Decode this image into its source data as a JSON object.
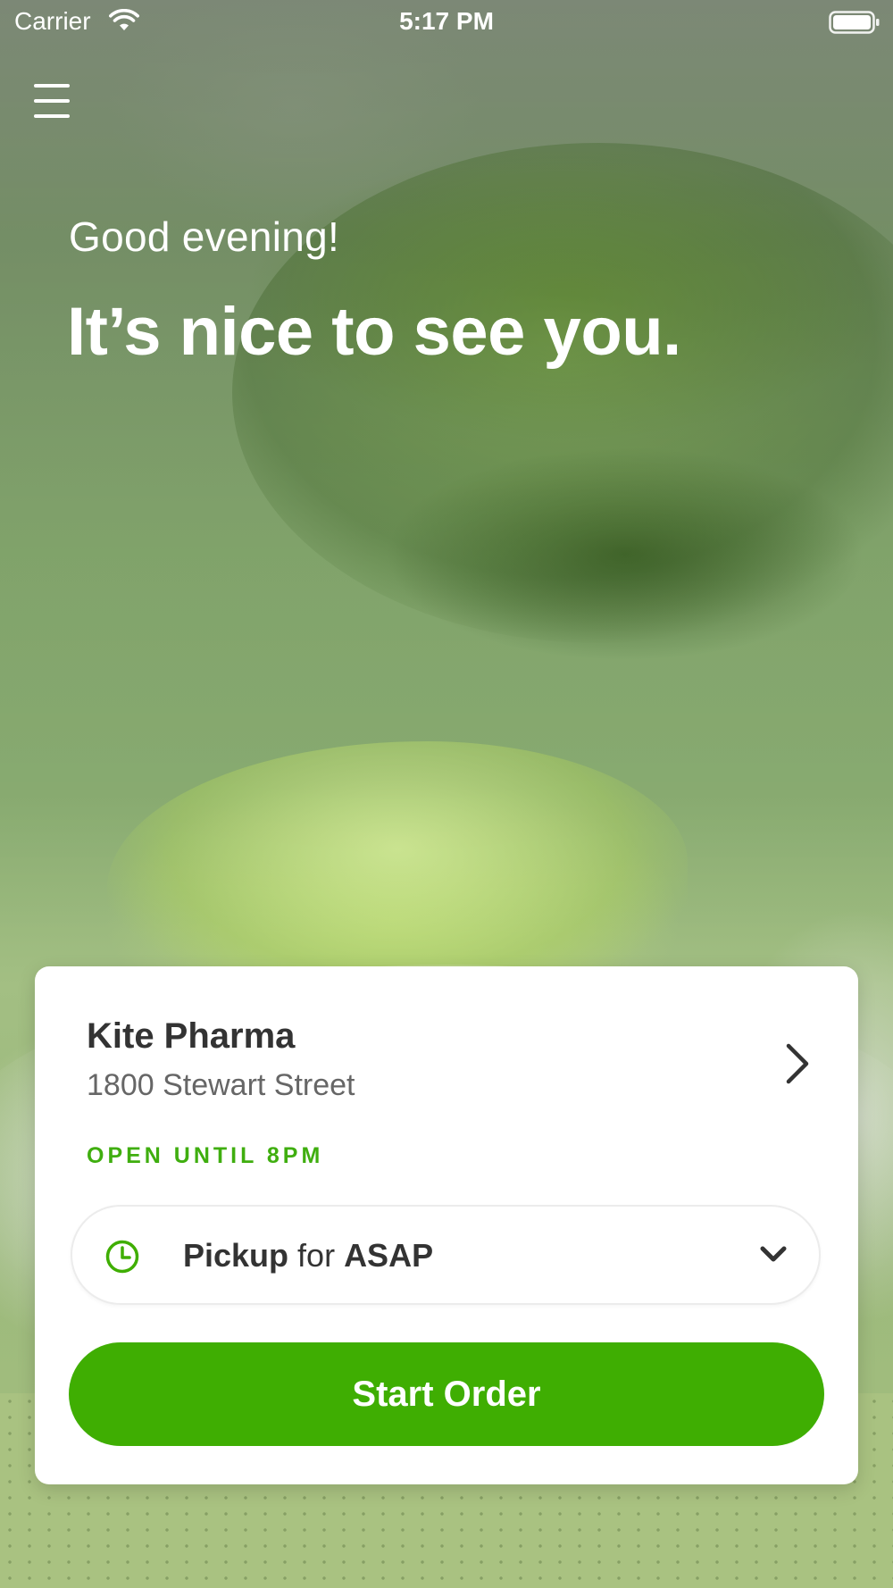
{
  "status_bar": {
    "carrier": "Carrier",
    "time": "5:17 PM"
  },
  "header": {
    "menu_icon": "hamburger-menu-icon"
  },
  "hero": {
    "greeting": "Good evening!",
    "headline": "It’s nice to see you."
  },
  "store": {
    "name": "Kite Pharma",
    "address": "1800 Stewart Street",
    "hours": "OPEN UNTIL 8PM"
  },
  "order_type": {
    "mode": "Pickup",
    "connector": " for ",
    "time": "ASAP"
  },
  "actions": {
    "start_order_label": "Start Order"
  },
  "colors": {
    "accent": "#3fae02",
    "hours_text": "#3fae0f",
    "primary_text": "#333333",
    "secondary_text": "#666666",
    "card_background": "#ffffff"
  }
}
